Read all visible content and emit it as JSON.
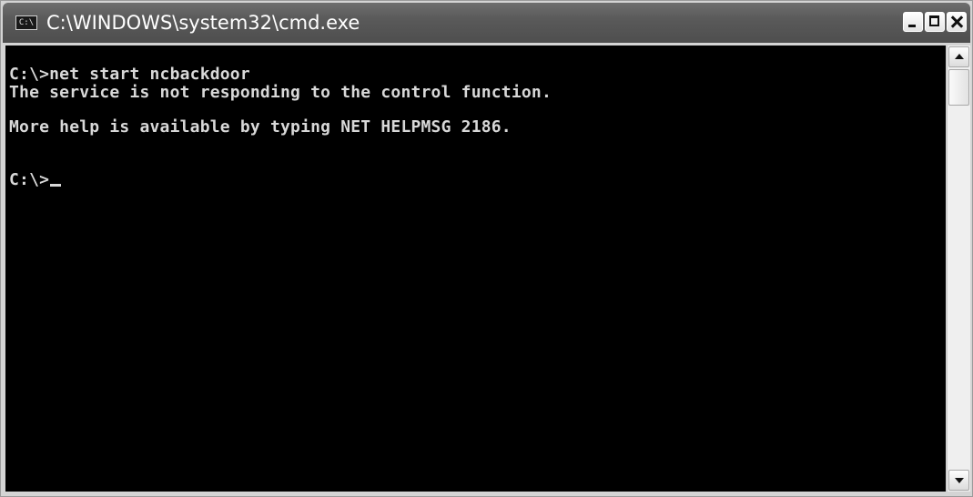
{
  "window": {
    "title": "C:\\WINDOWS\\system32\\cmd.exe",
    "icon": "console-app-icon",
    "icon_label": "C:\\",
    "controls": {
      "minimize": "minimize-icon",
      "maximize": "maximize-icon",
      "close": "close-icon"
    }
  },
  "console": {
    "lines": [
      "C:\\>net start ncbackdoor",
      "The service is not responding to the control function.",
      "More help is available by typing NET HELPMSG 2186.",
      "C:\\>"
    ],
    "background_color": "#000000",
    "text_color": "#d8d8d8"
  },
  "scrollbar": {
    "up_icon": "scroll-up-arrow-icon",
    "down_icon": "scroll-down-arrow-icon"
  }
}
